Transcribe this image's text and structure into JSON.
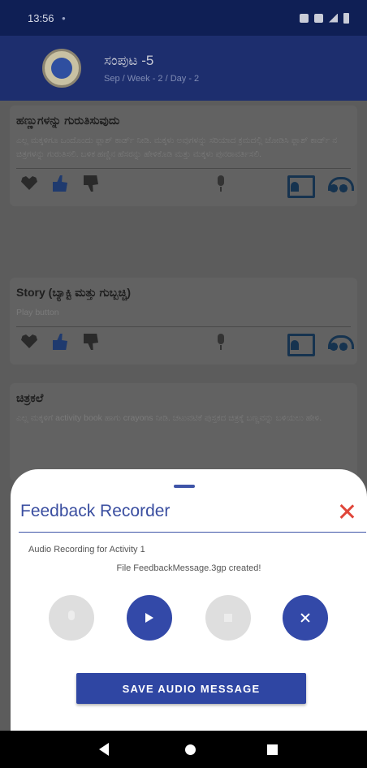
{
  "status_bar": {
    "time": "13:56",
    "dot": "•"
  },
  "app_bar": {
    "title": "ಸಂಪುಟ -5",
    "subtitle": "Sep / Week - 2 / Day - 2"
  },
  "cards": [
    {
      "title": "ಹಣ್ಣುಗಳನ್ನು ಗುರುತಿಸುವುದು",
      "body": "ಎಲ್ಲ ಮಕ್ಕಳಿಗೂ ಒಂದೊಂದು ಫ್ಲಾಶ್ ಕಾರ್ಡ್ ನೀಡಿ. ಮಕ್ಕಳು ಅವುಗಳನ್ನು ಸರಿಯಾದ ಕ್ರಮದಲ್ಲಿ ಜೋಡಿಸಿ ಫ್ಲಾಶ್ ಕಾರ್ಡ್ ನ ಚಿತ್ರಗಳನ್ನು ಗುರುತಿಸಲಿ. ಬಳಿಕ ಹಣ್ಣಿನ ಹೆಸರನ್ನು ಹೇಳಿಕೊಡಿ ಮತ್ತು ಮಕ್ಕಳು ಪುನರಾವರ್ತಿಸಲಿ."
    },
    {
      "title": "Story (ಬ್ಯಾಕ್ಟಿ ಮತ್ತು ಗುಬ್ಬಚ್ಚಿ)",
      "body": "Play button"
    },
    {
      "title": "ಚಿತ್ರಕಲೆ",
      "body": "ಎಲ್ಲ ಮಕ್ಕಳಿಗೆ activity book ಹಾಗು crayons ನೀಡಿ. ಚಟುವಟಿಕೆ ಪುಸ್ತಕದ ಚಿತ್ರಕ್ಕೆ ಬಣ್ಣವನ್ನು ಬಳಿಯಲು ಹೇಳಿ."
    }
  ],
  "sheet": {
    "title": "Feedback Recorder",
    "recording_label": "Audio Recording for Activity 1",
    "status_text": "File FeedbackMessage.3gp created!",
    "save_label": "SAVE AUDIO MESSAGE"
  },
  "colors": {
    "primary": "#3349a8",
    "close": "#e0463a",
    "disabled": "#dedede",
    "status_bar": "#0f1f55",
    "app_bar": "#1d2e6e"
  },
  "icons": {
    "card_actions": [
      "heart-icon",
      "thumbs-up-icon",
      "thumbs-down-icon",
      "microphone-icon",
      "record-voice-icon",
      "listen-icon"
    ],
    "controls": [
      "microphone-icon",
      "play-icon",
      "stop-icon",
      "close-icon"
    ],
    "nav": [
      "back-icon",
      "home-icon",
      "recents-icon"
    ]
  }
}
